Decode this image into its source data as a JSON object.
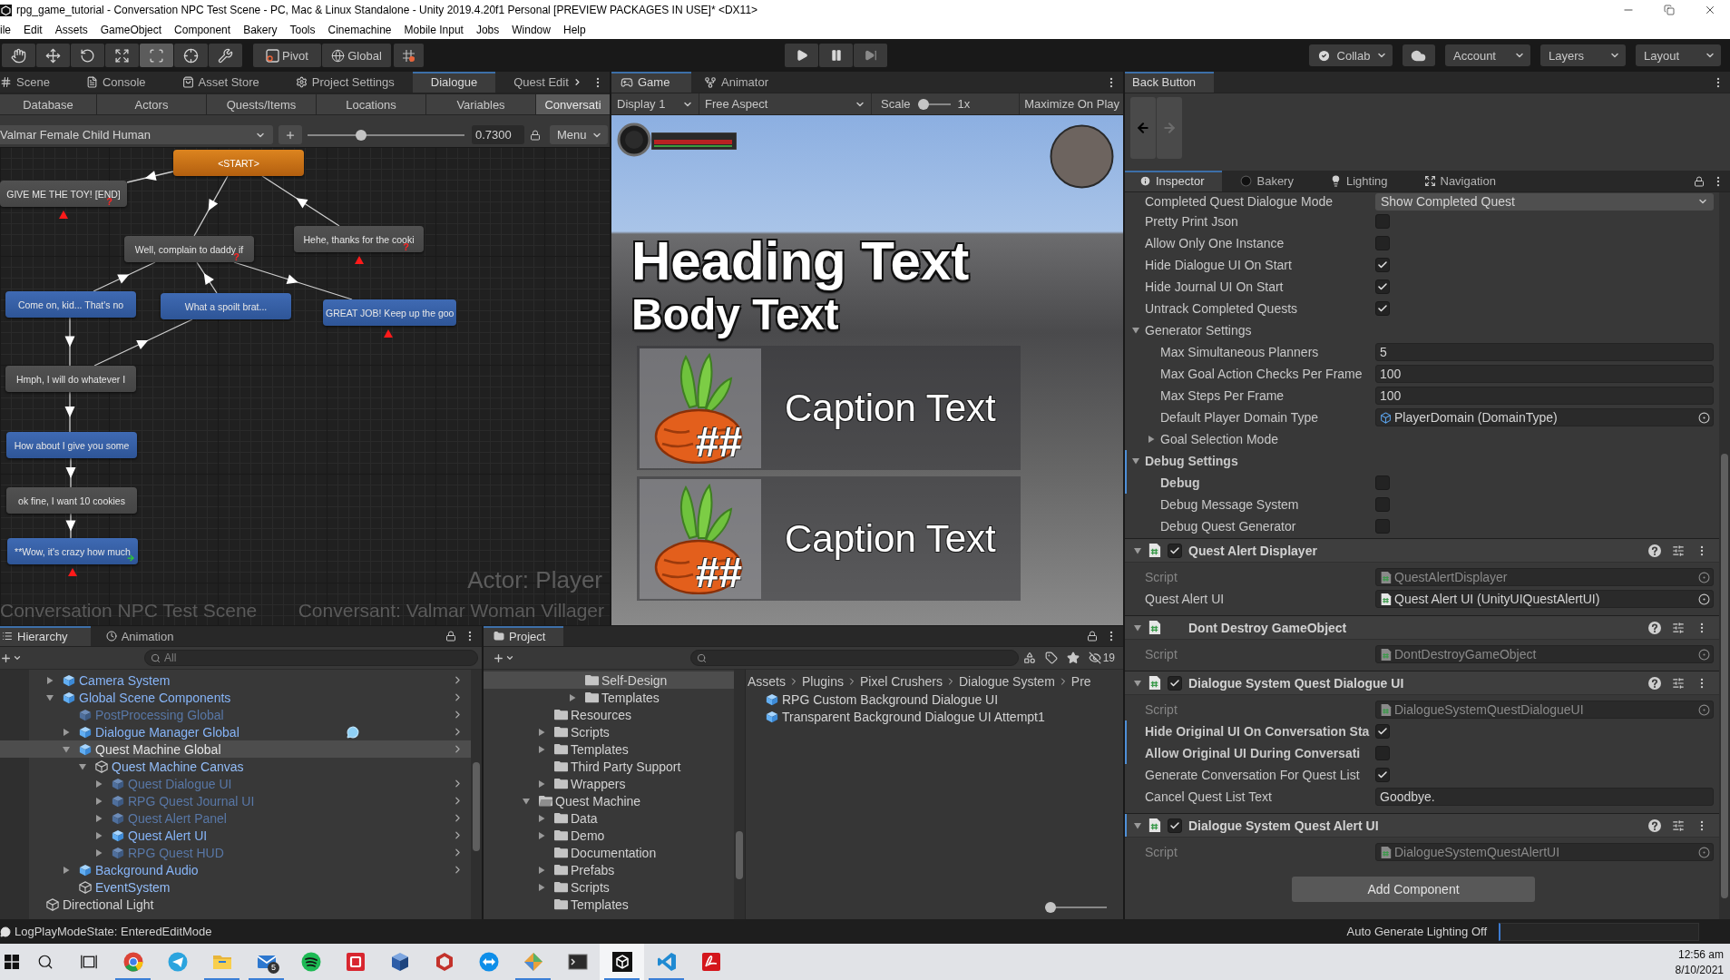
{
  "window": {
    "title": "rpg_game_tutorial - Conversation NPC Test Scene - PC, Mac & Linux Standalone - Unity 2019.4.20f1 Personal [PREVIEW PACKAGES IN USE]* <DX11>"
  },
  "menu": [
    "ile",
    "Edit",
    "Assets",
    "GameObject",
    "Component",
    "Bakery",
    "Tools",
    "Cinemachine",
    "Mobile Input",
    "Jobs",
    "Window",
    "Help"
  ],
  "toolbar": {
    "tools": [
      {
        "selected": false
      },
      {
        "selected": false
      },
      {
        "selected": false
      },
      {
        "selected": false
      },
      {
        "selected": true
      },
      {
        "selected": false
      },
      {
        "selected": false
      }
    ],
    "pivot": "Pivot",
    "space": "Global",
    "collab": "Collab",
    "account": "Account",
    "layers": "Layers",
    "layout": "Layout"
  },
  "dialogue_panel": {
    "tabs": [
      {
        "label": "Scene",
        "selected": false
      },
      {
        "label": "Console",
        "selected": false
      },
      {
        "label": "Asset Store",
        "selected": false
      },
      {
        "label": "Project Settings",
        "selected": false
      },
      {
        "label": "Dialogue",
        "selected": true
      },
      {
        "label": "Quest Edit",
        "selected": false
      }
    ],
    "sections": [
      {
        "label": "Database",
        "selected": false
      },
      {
        "label": "Actors",
        "selected": false
      },
      {
        "label": "Quests/Items",
        "selected": false
      },
      {
        "label": "Locations",
        "selected": false
      },
      {
        "label": "Variables",
        "selected": false
      },
      {
        "label": "Conversati",
        "selected": true
      }
    ],
    "conversation": "Valmar Female Child Human",
    "zoom": {
      "level": 0.33,
      "reading": "0.7300"
    },
    "menu": "Menu",
    "nodes": [
      {
        "text": "<START>",
        "kind": "start",
        "end": false,
        "link": false
      },
      {
        "text": "GIVE ME THE TOY! [END]",
        "kind": "npc",
        "badge": "?",
        "end": true,
        "link": false
      },
      {
        "text": "Well, complain to daddy if",
        "kind": "npc",
        "badge": "?",
        "end": false,
        "link": false
      },
      {
        "text": "Hehe, thanks for the cooki",
        "kind": "npc",
        "badge": "?",
        "end": true,
        "link": false
      },
      {
        "text": "Come on, kid... That's no",
        "kind": "player",
        "end": false,
        "link": false
      },
      {
        "text": "What a spoilt brat...",
        "kind": "player",
        "end": false,
        "link": false
      },
      {
        "text": "GREAT JOB! Keep up the goo",
        "kind": "player",
        "end": true,
        "link": false
      },
      {
        "text": "Hmph, I will do whatever I",
        "kind": "npc",
        "end": false,
        "link": false
      },
      {
        "text": "How about I give you some",
        "kind": "player",
        "end": false,
        "link": false
      },
      {
        "text": "ok fine, I want 10 cookies",
        "kind": "npc",
        "end": false,
        "link": false
      },
      {
        "text": "**Wow, it's crazy how much",
        "kind": "player",
        "end": true,
        "link": true
      }
    ],
    "actor_label": "Actor: Player",
    "scene_label": "Conversation NPC Test Scene",
    "conversant_label": "Conversant: Valmar Woman Villager"
  },
  "game_panel": {
    "tabs": [
      {
        "label": "Game",
        "selected": true
      },
      {
        "label": "Animator",
        "selected": false
      }
    ],
    "display": "Display 1",
    "aspect": "Free Aspect",
    "scale_label": "Scale",
    "scale": {
      "level": 0,
      "reading": "1x"
    },
    "maximize": {
      "label": "Maximize On Play",
      "on": false
    },
    "heading": "Heading Text",
    "body": "Body Text",
    "captions": [
      {
        "mark": "##",
        "text": "Caption Text"
      },
      {
        "mark": "##",
        "text": "Caption Text"
      }
    ]
  },
  "back_panel": {
    "tab": "Back Button"
  },
  "inspector": {
    "tabs": [
      {
        "label": "Inspector",
        "selected": true
      },
      {
        "label": "Bakery",
        "selected": false
      },
      {
        "label": "Lighting",
        "selected": false
      },
      {
        "label": "Navigation",
        "selected": false
      }
    ],
    "properties": [
      {
        "kind": "dropdown",
        "label": "Completed Quest Dialogue Mode",
        "value": "Show Completed Quest",
        "modified": false
      },
      {
        "kind": "checkbox",
        "label": "Pretty Print Json",
        "checked": false,
        "modified": false
      },
      {
        "kind": "checkbox",
        "label": "Allow Only One Instance",
        "checked": false,
        "modified": false
      },
      {
        "kind": "checkbox",
        "label": "Hide Dialogue UI On Start",
        "checked": true,
        "modified": false
      },
      {
        "kind": "checkbox",
        "label": "Hide Journal UI On Start",
        "checked": true,
        "modified": false
      },
      {
        "kind": "checkbox",
        "label": "Untrack Completed Quests",
        "checked": true,
        "modified": false
      },
      {
        "kind": "foldout",
        "label": "Generator Settings",
        "expanded": true,
        "modified": false,
        "children": [
          {
            "kind": "text",
            "label": "Max Simultaneous Planners",
            "value": "5",
            "modified": false
          },
          {
            "kind": "text",
            "label": "Max Goal Action Checks Per Frame",
            "value": "100",
            "modified": false
          },
          {
            "kind": "text",
            "label": "Max Steps Per Frame",
            "value": "100",
            "modified": false
          },
          {
            "kind": "asset",
            "label": "Default Player Domain Type",
            "value": "PlayerDomain (DomainType)",
            "modified": false
          },
          {
            "kind": "foldout",
            "label": "Goal Selection Mode",
            "expanded": false,
            "modified": false
          }
        ]
      },
      {
        "kind": "foldout",
        "label": "Debug Settings",
        "expanded": true,
        "modified": true,
        "children": [
          {
            "kind": "checkbox",
            "label": "Debug",
            "checked": false,
            "modified": true
          },
          {
            "kind": "checkbox",
            "label": "Debug Message System",
            "checked": false,
            "modified": false
          },
          {
            "kind": "checkbox",
            "label": "Debug Quest Generator",
            "checked": false,
            "modified": false
          }
        ]
      }
    ],
    "components": [
      {
        "title": "Quest Alert Displayer",
        "enabled": true,
        "expanded": true,
        "modified": false,
        "fields": [
          {
            "kind": "script",
            "label": "Script",
            "value": "QuestAlertDisplayer",
            "modified": false
          },
          {
            "kind": "object",
            "label": "Quest Alert UI",
            "value": "Quest Alert UI (UnityUIQuestAlertUI)",
            "modified": false
          }
        ]
      },
      {
        "title": "Dont Destroy GameObject",
        "expanded": true,
        "modified": false,
        "fields": [
          {
            "kind": "script",
            "label": "Script",
            "value": "DontDestroyGameObject",
            "modified": false
          }
        ]
      },
      {
        "title": "Dialogue System Quest Dialogue UI",
        "enabled": true,
        "expanded": true,
        "modified": false,
        "fields": [
          {
            "kind": "script",
            "label": "Script",
            "value": "DialogueSystemQuestDialogueUI",
            "modified": false
          },
          {
            "kind": "checkbox",
            "label": "Hide Original UI On Conversation Sta",
            "checked": true,
            "modified": true
          },
          {
            "kind": "checkbox",
            "label": "Allow Original UI During Conversati",
            "checked": false,
            "modified": true
          },
          {
            "kind": "checkbox",
            "label": "Generate Conversation For Quest List",
            "checked": true,
            "modified": false
          },
          {
            "kind": "text",
            "label": "Cancel Quest List Text",
            "value": "Goodbye.",
            "modified": false
          }
        ]
      },
      {
        "title": "Dialogue System Quest Alert UI",
        "enabled": true,
        "expanded": true,
        "modified": true,
        "fields": [
          {
            "kind": "script",
            "label": "Script",
            "value": "DialogueSystemQuestAlertUI",
            "modified": false
          }
        ]
      }
    ],
    "add_component": "Add Component"
  },
  "hierarchy": {
    "tabs": [
      {
        "label": "Hierarchy",
        "selected": true
      },
      {
        "label": "Animation",
        "selected": false
      }
    ],
    "search": {
      "placeholder": "All"
    },
    "items": [
      {
        "children": [
          {
            "name": "Camera System",
            "kind": "prefab",
            "active": true,
            "expanded": false,
            "selected": false
          },
          {
            "name": "Global Scene Components",
            "kind": "prefab",
            "active": true,
            "expanded": true,
            "selected": false,
            "children": [
              {
                "name": "PostProcessing Global",
                "kind": "prefab",
                "active": false,
                "selected": false
              },
              {
                "name": "Dialogue Manager Global",
                "kind": "prefab",
                "active": true,
                "expanded": false,
                "selected": false,
                "gizmo": true
              },
              {
                "name": "Quest Machine Global",
                "kind": "prefab",
                "active": true,
                "expanded": true,
                "selected": true,
                "children": [
                  {
                    "name": "Quest Machine Canvas",
                    "kind": "prefab_part",
                    "active": true,
                    "expanded": true,
                    "selected": false,
                    "children": [
                      {
                        "name": "Quest Dialogue UI",
                        "kind": "prefab",
                        "active": false,
                        "expanded": false,
                        "selected": false
                      },
                      {
                        "name": "RPG Quest Journal UI",
                        "kind": "prefab",
                        "active": false,
                        "expanded": false,
                        "selected": false
                      },
                      {
                        "name": "Quest Alert Panel",
                        "kind": "prefab",
                        "active": false,
                        "expanded": false,
                        "selected": false
                      },
                      {
                        "name": "Quest Alert UI",
                        "kind": "prefab",
                        "active": true,
                        "expanded": false,
                        "selected": false
                      },
                      {
                        "name": "RPG Quest HUD",
                        "kind": "prefab",
                        "active": false,
                        "expanded": false,
                        "selected": false
                      }
                    ]
                  }
                ]
              },
              {
                "name": "Background Audio",
                "kind": "prefab",
                "active": true,
                "expanded": false,
                "selected": false
              },
              {
                "name": "EventSystem",
                "kind": "prefab_part",
                "active": true,
                "selected": false
              }
            ]
          }
        ]
      },
      {
        "name": "Directional Light",
        "kind": "object",
        "active": true,
        "selected": false
      }
    ]
  },
  "project": {
    "tab": {
      "label": "Project",
      "selected": true
    },
    "hidden_count": "19",
    "folders": [
      {
        "children": [
          {
            "children": [
              {
                "children": [
                  {
                    "name": "Self-Design",
                    "selected": true
                  },
                  {
                    "name": "Templates",
                    "expanded": false,
                    "selected": false
                  }
                ]
              }
            ]
          },
          {
            "name": "Resources",
            "selected": false
          },
          {
            "name": "Scripts",
            "expanded": false,
            "selected": false
          },
          {
            "name": "Templates",
            "expanded": false,
            "selected": false
          },
          {
            "name": "Third Party Support",
            "selected": false
          },
          {
            "name": "Wrappers",
            "expanded": false,
            "selected": false
          }
        ]
      },
      {
        "name": "Quest Machine",
        "expanded": true,
        "selected": false,
        "children": [
          {
            "name": "Data",
            "expanded": false,
            "selected": false
          },
          {
            "name": "Demo",
            "expanded": false,
            "selected": false
          },
          {
            "name": "Documentation",
            "selected": false
          },
          {
            "name": "Prefabs",
            "expanded": false,
            "selected": false
          },
          {
            "name": "Scripts",
            "expanded": false,
            "selected": false
          },
          {
            "name": "Templates",
            "selected": false
          }
        ]
      }
    ],
    "breadcrumb": [
      "Assets",
      "Plugins",
      "Pixel Crushers",
      "Dialogue System",
      "Pre"
    ],
    "assets": [
      "RPG Custom Background Dialogue UI",
      "Transparent Background Dialogue UI Attempt1"
    ],
    "icon_size": {
      "level": 0
    }
  },
  "status_bar": {
    "message": "LogPlayModeState: EnteredEditMode",
    "lighting": "Auto Generate Lighting Off"
  },
  "taskbar": {
    "apps": [
      {
        "running": true,
        "selected": false
      },
      {
        "running": false,
        "selected": false
      },
      {
        "running": true,
        "selected": false
      },
      {
        "running": true,
        "selected": false,
        "badge": "5"
      },
      {
        "running": false,
        "selected": false
      },
      {
        "running": false,
        "selected": false
      },
      {
        "running": false,
        "selected": false
      },
      {
        "running": false,
        "selected": false
      },
      {
        "running": false,
        "selected": false
      },
      {
        "running": true,
        "selected": false
      },
      {
        "running": false,
        "selected": false
      },
      {
        "running": true,
        "selected": true
      },
      {
        "running": true,
        "selected": false
      },
      {
        "running": false,
        "selected": false
      }
    ],
    "time": "12:56 am",
    "date": "8/10/2021"
  }
}
